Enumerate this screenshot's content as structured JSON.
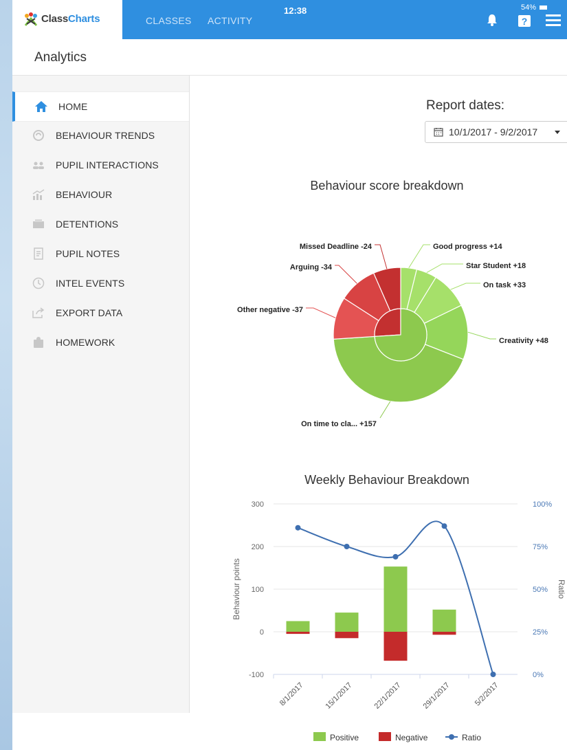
{
  "topbar": {
    "brand_part1": "Class",
    "brand_part2": "Charts",
    "nav_classes": "CLASSES",
    "nav_activity": "ACTIVITY",
    "clock": "12:38",
    "battery": "54%",
    "accent": "#2f8fe0"
  },
  "page": {
    "title": "Analytics"
  },
  "sidebar": {
    "items": [
      {
        "label": "HOME",
        "icon": "home-icon",
        "active": true
      },
      {
        "label": "BEHAVIOUR TRENDS",
        "icon": "trends-icon"
      },
      {
        "label": "PUPIL INTERACTIONS",
        "icon": "people-icon"
      },
      {
        "label": "BEHAVIOUR",
        "icon": "bar-chart-icon"
      },
      {
        "label": "DETENTIONS",
        "icon": "detention-icon"
      },
      {
        "label": "PUPIL NOTES",
        "icon": "notes-icon"
      },
      {
        "label": "INTEL EVENTS",
        "icon": "clock-icon"
      },
      {
        "label": "EXPORT DATA",
        "icon": "export-icon"
      },
      {
        "label": "HOMEWORK",
        "icon": "homework-icon"
      }
    ]
  },
  "report": {
    "label": "Report dates:",
    "range": "10/1/2017 - 9/2/2017"
  },
  "chart_data": [
    {
      "type": "pie",
      "title": "Behaviour score breakdown",
      "series": [
        {
          "name": "Good progress",
          "value": 14,
          "color": "#a6e06a"
        },
        {
          "name": "Star Student",
          "value": 18,
          "color": "#a6e06a"
        },
        {
          "name": "On task",
          "value": 33,
          "color": "#a6e06a"
        },
        {
          "name": "Creativity",
          "value": 48,
          "color": "#95d65a"
        },
        {
          "name": "On time to cla...",
          "value": 157,
          "color": "#8dc94e"
        },
        {
          "name": "Other negative",
          "value": -37,
          "color": "#e45353"
        },
        {
          "name": "Arguing",
          "value": -34,
          "color": "#d84343"
        },
        {
          "name": "Missed Deadline",
          "value": -24,
          "color": "#c33030"
        }
      ],
      "labels": [
        "Good progress +14",
        "Star Student +18",
        "On task +33",
        "Creativity +48",
        "On time to cla... +157",
        "Other negative -37",
        "Arguing -34",
        "Missed Deadline -24"
      ],
      "inner_ring": [
        {
          "name": "Positive",
          "value": 270,
          "color": "#8dc94e"
        },
        {
          "name": "Negative",
          "value": 95,
          "color": "#c33030"
        }
      ]
    },
    {
      "type": "bar",
      "title": "Weekly Behaviour Breakdown",
      "categories": [
        "8/1/2017",
        "15/1/2017",
        "22/1/2017",
        "29/1/2017",
        "5/2/2017"
      ],
      "series": [
        {
          "name": "Positive",
          "values": [
            25,
            45,
            153,
            52,
            0
          ],
          "color": "#8dc94e"
        },
        {
          "name": "Negative",
          "values": [
            -5,
            -15,
            -68,
            -7,
            0
          ],
          "color": "#c42b2b"
        },
        {
          "name": "Ratio",
          "values": [
            86,
            75,
            69,
            87,
            0
          ],
          "color": "#3e6fb0",
          "axis": "right",
          "unit": "%"
        }
      ],
      "ylabel": "Behaviour points",
      "y2label": "Ratio",
      "ylim": [
        -100,
        300
      ],
      "y_ticks": [
        "300",
        "200",
        "100",
        "0",
        "-100"
      ],
      "y2lim": [
        0,
        100
      ],
      "y2_ticks": [
        "100%",
        "75%",
        "50%",
        "25%",
        "0%"
      ],
      "legend": [
        "Positive",
        "Negative",
        "Ratio"
      ],
      "legend_position": "bottom"
    }
  ]
}
